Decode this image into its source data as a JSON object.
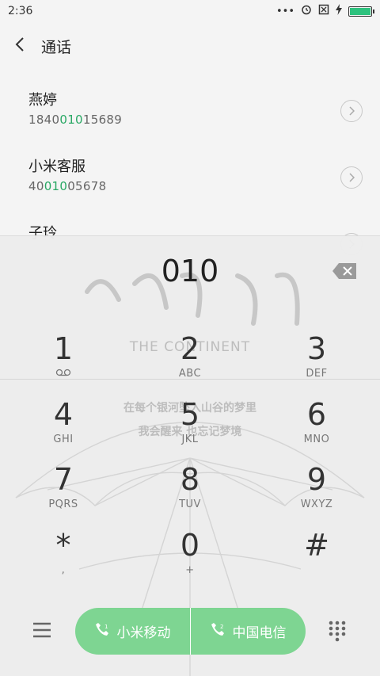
{
  "status_bar": {
    "time": "2:36",
    "icons": [
      "more-dots-icon",
      "alarm-icon",
      "no-sim-icon",
      "charging-icon",
      "battery-icon"
    ],
    "battery_color": "#2ec27e"
  },
  "header": {
    "back_icon": "‹",
    "title": "通话"
  },
  "contacts": [
    {
      "name": "燕婷",
      "number_prefix": "1840",
      "number_match": "010",
      "number_suffix": "15689"
    },
    {
      "name": "小米客服",
      "number_prefix": "40",
      "number_match": "010",
      "number_suffix": "05678"
    },
    {
      "name": "子玲",
      "number_prefix": "",
      "number_match": "",
      "number_suffix": ""
    }
  ],
  "dialpad": {
    "entered_digits": "010",
    "wallpaper": {
      "title_line": "THE CONTINENT",
      "poem_line_1": "在每个银河坠入山谷的梦里",
      "poem_line_2": "我会醒来 也忘记梦境",
      "script": "后会无期"
    },
    "keys": [
      {
        "num": "1",
        "sub": "voicemail"
      },
      {
        "num": "2",
        "sub": "ABC"
      },
      {
        "num": "3",
        "sub": "DEF"
      },
      {
        "num": "4",
        "sub": "GHI"
      },
      {
        "num": "5",
        "sub": "JKL"
      },
      {
        "num": "6",
        "sub": "MNO"
      },
      {
        "num": "7",
        "sub": "PQRS"
      },
      {
        "num": "8",
        "sub": "TUV"
      },
      {
        "num": "9",
        "sub": "WXYZ"
      },
      {
        "num": "*",
        "sub": ","
      },
      {
        "num": "0",
        "sub": "+"
      },
      {
        "num": "#",
        "sub": ""
      }
    ],
    "call_buttons": [
      {
        "label": "小米移动"
      },
      {
        "label": "中国电信"
      }
    ],
    "accent_color": "#7ed592",
    "match_color": "#2aa865"
  }
}
